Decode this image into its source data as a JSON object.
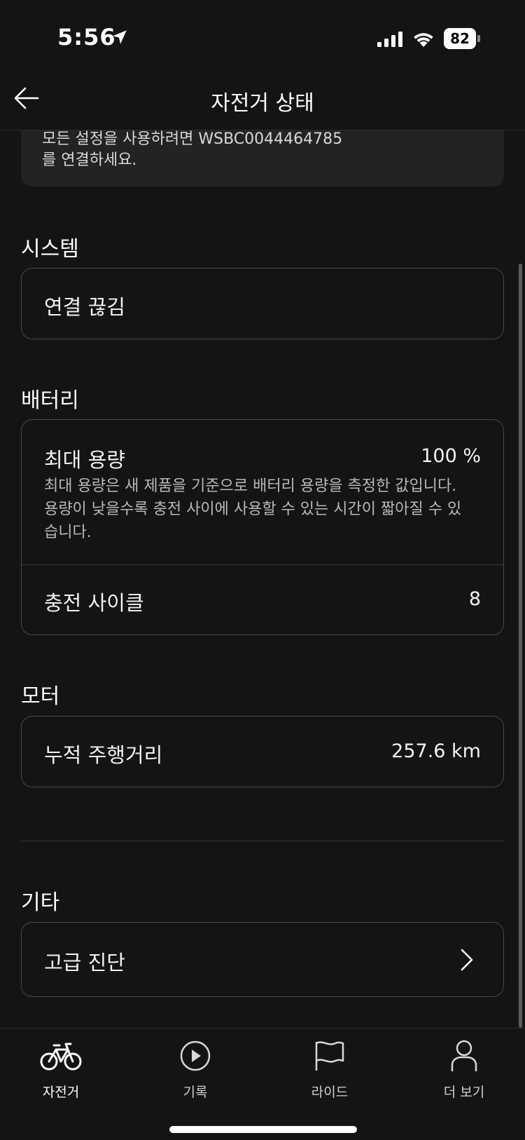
{
  "status_bar": {
    "time": "5:56",
    "battery_level": "82",
    "icons": [
      "location-arrow-icon",
      "cellular-signal-icon",
      "wifi-icon",
      "battery-icon"
    ]
  },
  "header": {
    "title": "자전거 상태",
    "back_icon": "arrow-left-icon"
  },
  "notice": {
    "line1": "모든 설정을 사용하려면 WSBC0044464785",
    "line2": "를 연결하세요."
  },
  "system": {
    "title": "시스템",
    "status": "연결 끊김"
  },
  "battery": {
    "title": "배터리",
    "max_capacity_label": "최대 용량",
    "max_capacity_value": "100 %",
    "max_capacity_desc": "최대 용량은 새 제품을 기준으로 배터리 용량을 측정한 값입니다. 용량이 낮을수록 충전 사이에 사용할 수 있는 시간이 짧아질 수 있습니다.",
    "charge_cycles_label": "충전 사이클",
    "charge_cycles_value": "8"
  },
  "motor": {
    "title": "모터",
    "odometer_label": "누적 주행거리",
    "odometer_value": "257.6 km"
  },
  "other": {
    "title": "기타",
    "advanced_diagnostics_label": "고급 진단"
  },
  "tab_bar": {
    "tabs": [
      {
        "label": "자전거",
        "icon": "bicycle-icon",
        "active": true
      },
      {
        "label": "기록",
        "icon": "play-circle-icon",
        "active": false
      },
      {
        "label": "라이드",
        "icon": "flag-icon",
        "active": false
      },
      {
        "label": "더 보기",
        "icon": "person-icon",
        "active": false
      }
    ]
  },
  "colors": {
    "background": "#141414",
    "card_border": "#4a4a4a",
    "notice_bg": "#232323",
    "text": "#f2f2f2",
    "muted_text": "#b9b9b9"
  }
}
